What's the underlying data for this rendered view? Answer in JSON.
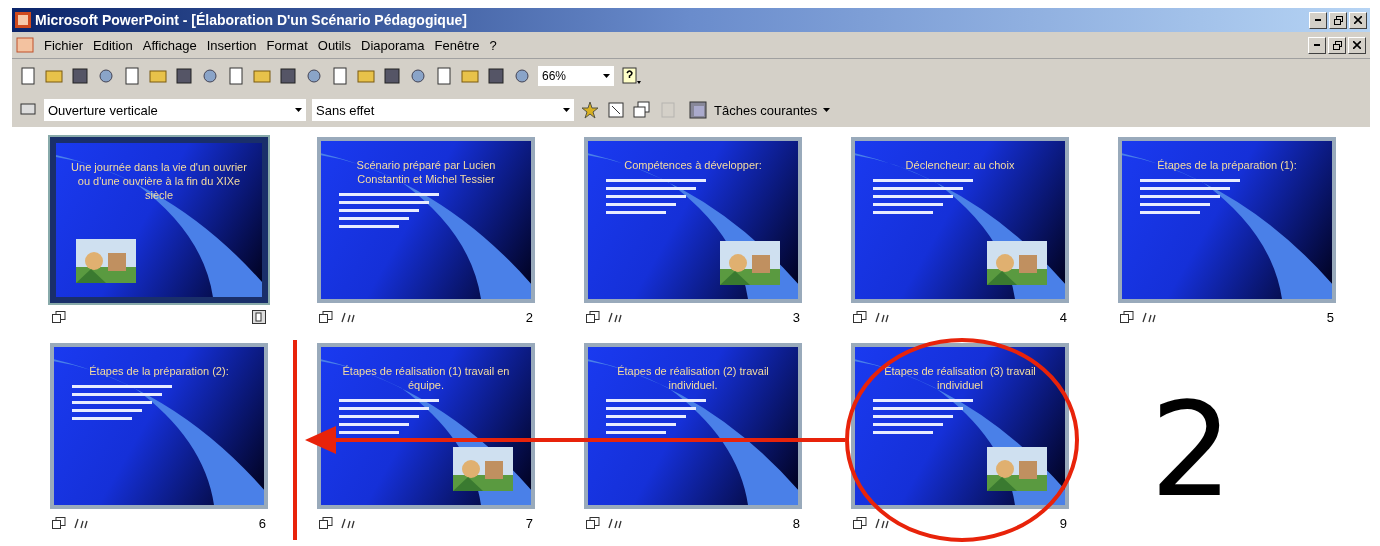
{
  "window": {
    "title": "Microsoft PowerPoint - [Élaboration D'un Scénario Pédagogique]"
  },
  "menu": [
    "Fichier",
    "Edition",
    "Affichage",
    "Insertion",
    "Format",
    "Outils",
    "Diaporama",
    "Fenêtre",
    "?"
  ],
  "toolbar": {
    "zoom": "66%"
  },
  "formatting_toolbar": {
    "transition": "Ouverture verticale",
    "animation": "Sans effet",
    "tasks_button": "Tâches courantes"
  },
  "slides": [
    {
      "title": "Une journée dans la vie d'un ouvrier ou d'une ouvrière à la fin du XIXe siècle",
      "selected": true,
      "animated": false,
      "has_picture": true
    },
    {
      "number": "2",
      "title": "Scénario préparé par Lucien Constantin et Michel Tessier",
      "selected": false,
      "animated": true,
      "has_picture": false
    },
    {
      "number": "3",
      "title": "Compétences à développer:",
      "selected": false,
      "animated": true,
      "has_picture": true
    },
    {
      "number": "4",
      "title": "Déclencheur: au choix",
      "selected": false,
      "animated": true,
      "has_picture": true
    },
    {
      "number": "5",
      "title": "Étapes de la préparation (1):",
      "selected": false,
      "animated": true,
      "has_picture": false
    },
    {
      "number": "6",
      "title": "Étapes de la préparation (2):",
      "selected": false,
      "animated": true,
      "has_picture": false
    },
    {
      "number": "7",
      "title": "Étapes de réalisation (1) travail en équipe.",
      "selected": false,
      "animated": true,
      "has_picture": true
    },
    {
      "number": "8",
      "title": "Étapes de réalisation (2) travail individuel.",
      "selected": false,
      "animated": true,
      "has_picture": false
    },
    {
      "number": "9",
      "title": "Étapes de réalisation (3) travail individuel",
      "selected": false,
      "animated": true,
      "has_picture": true
    }
  ],
  "annotation": {
    "label": "2"
  }
}
